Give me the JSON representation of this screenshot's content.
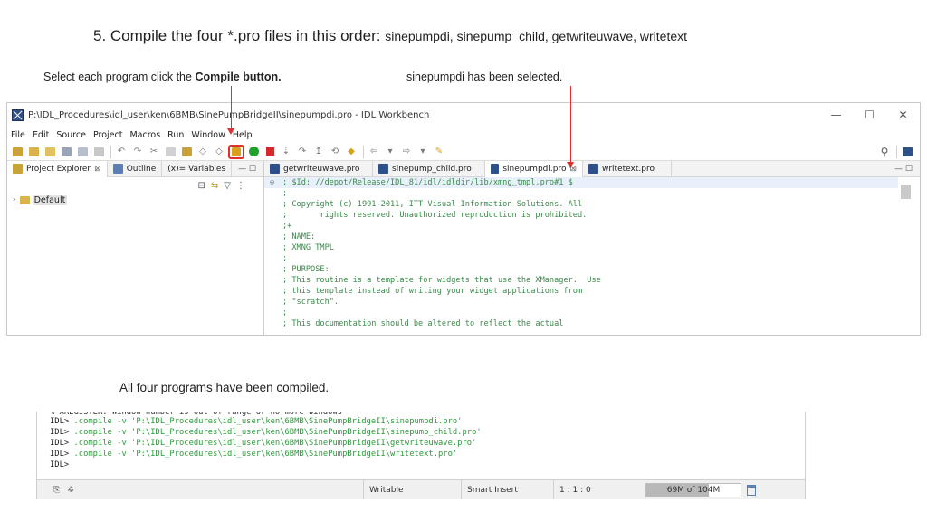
{
  "slide": {
    "title_main": "5. Compile the four *.pro files in this order: ",
    "title_files": "sinepumpdi, sinepump_child, getwriteuwave, writetext",
    "note_left_pre": "Select each program click the ",
    "note_left_bold": "Compile button.",
    "note_right": "sinepumpdi has been selected.",
    "note_bottom": "All four programs have been compiled.",
    "arrow_color": "#e03030"
  },
  "window": {
    "title": "P:\\IDL_Procedures\\idl_user\\ken\\6BMB\\SinePumpBridgeII\\sinepumpdi.pro - IDL Workbench",
    "controls": [
      "—",
      "☐",
      "✕"
    ],
    "menu": [
      "File",
      "Edit",
      "Source",
      "Project",
      "Macros",
      "Run",
      "Window",
      "Help"
    ]
  },
  "left_tabs": [
    {
      "label": "Project Explorer",
      "closable": true,
      "active": true,
      "icon_color": "#c9a23a"
    },
    {
      "label": "Outline",
      "closable": false,
      "active": false,
      "icon_color": "#5a7fb5"
    },
    {
      "label": "(x)= Variables",
      "closable": false,
      "active": false,
      "icon_color": "#ffffff"
    }
  ],
  "left_tools": [
    "⊟",
    "⇆",
    "▽",
    "⋮"
  ],
  "tree": [
    {
      "label": "Default"
    }
  ],
  "editor_tabs": [
    {
      "label": "getwriteuwave.pro",
      "active": false
    },
    {
      "label": "sinepump_child.pro",
      "active": false
    },
    {
      "label": "sinepumpdi.pro",
      "active": true
    },
    {
      "label": "writetext.pro",
      "active": false
    }
  ],
  "tab_controls": "— ☐",
  "code_lines": [
    "; $Id: //depot/Release/IDL_81/idl/idldir/lib/xmng_tmpl.pro#1 $",
    ";",
    "; Copyright (c) 1991-2011, ITT Visual Information Solutions. All",
    ";       rights reserved. Unauthorized reproduction is prohibited.",
    ";+",
    "; NAME:",
    "; XMNG_TMPL",
    ";",
    "; PURPOSE:",
    "; This routine is a template for widgets that use the XManager.  Use",
    "; this template instead of writing your widget applications from",
    "; \"scratch\".",
    ";",
    "; This documentation should be altered to reflect the actual"
  ],
  "console": {
    "cut_line": "% XREGISTER: Window number is out of range or no more windows",
    "lines": [
      {
        "prompt": "IDL> ",
        "cmd": ".compile -v 'P:\\IDL_Procedures\\idl_user\\ken\\6BMB\\SinePumpBridgeII\\sinepumpdi.pro'"
      },
      {
        "prompt": "IDL> ",
        "cmd": ".compile -v 'P:\\IDL_Procedures\\idl_user\\ken\\6BMB\\SinePumpBridgeII\\sinepump_child.pro'"
      },
      {
        "prompt": "IDL> ",
        "cmd": ".compile -v 'P:\\IDL_Procedures\\idl_user\\ken\\6BMB\\SinePumpBridgeII\\getwriteuwave.pro'"
      },
      {
        "prompt": "IDL> ",
        "cmd": ".compile -v 'P:\\IDL_Procedures\\idl_user\\ken\\6BMB\\SinePumpBridgeII\\writetext.pro'"
      },
      {
        "prompt": "IDL>",
        "cmd": ""
      }
    ]
  },
  "status": {
    "writable": "Writable",
    "insert_mode": "Smart Insert",
    "position": "1 : 1 : 0",
    "heap": "69M of 104M",
    "heap_used_fraction": 0.66
  },
  "colors": {
    "code_comment": "#3a8a4a",
    "console_cmd": "#2a9a3a",
    "highlight": "#e03030"
  }
}
